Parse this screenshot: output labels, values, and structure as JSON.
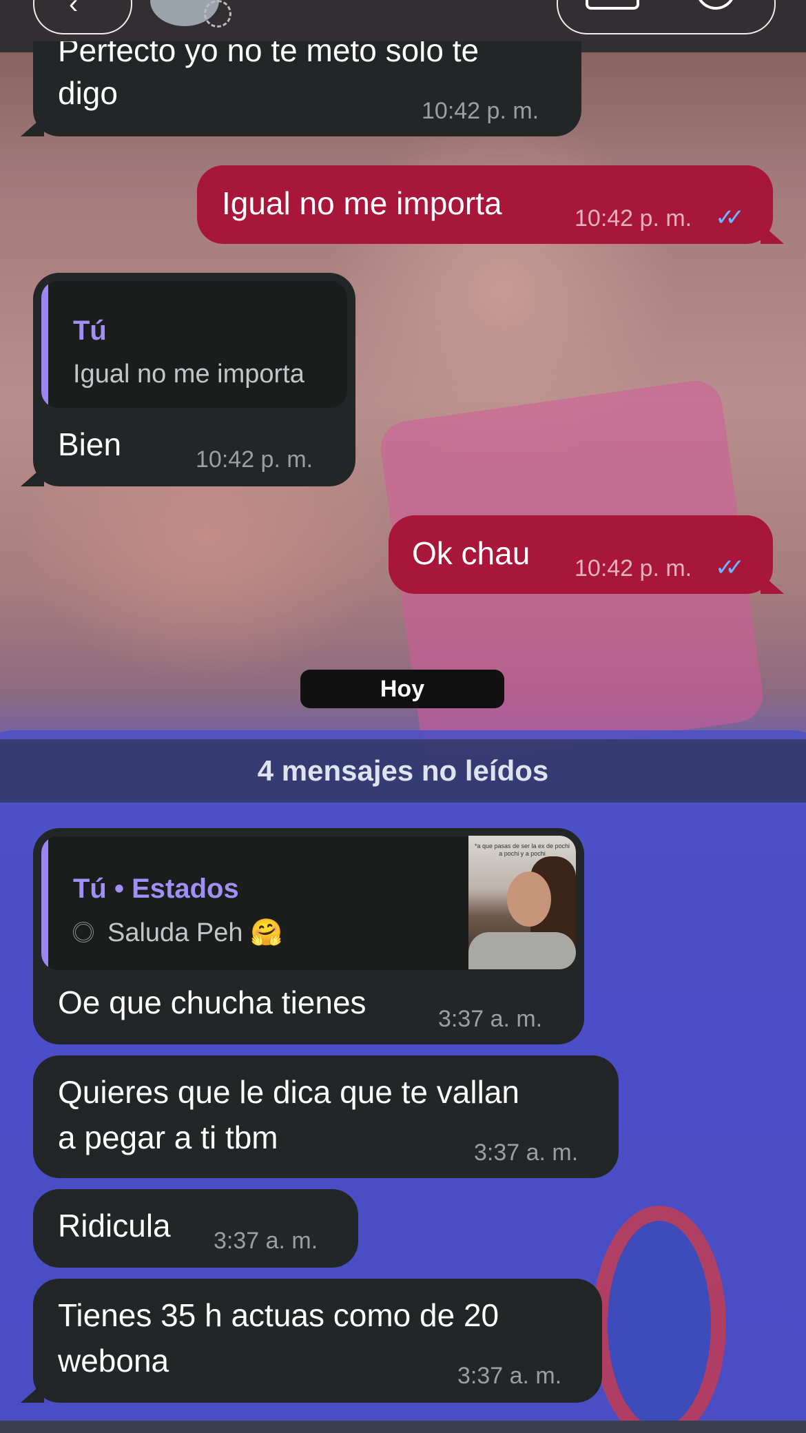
{
  "top": {
    "partial_message_top": "Perfecto yo no te meto solo te",
    "partial_message_bottom": "digo",
    "partial_time": "10:42 p. m."
  },
  "messages": [
    {
      "text": "Igual no me importa",
      "time": "10:42 p. m.",
      "ticks": "✓✓"
    },
    {
      "quote_name": "Tú",
      "quote_text": "Igual no me importa",
      "text": "Bien",
      "time": "10:42 p. m."
    },
    {
      "text": "Ok chau",
      "time": "10:42 p. m.",
      "ticks": "✓✓"
    }
  ],
  "day_label": "Hoy",
  "unread_label": "4 mensajes no leídos",
  "status_reply": {
    "quote_name": "Tú • Estados",
    "quote_text": "Saluda Peh 🤗",
    "thumb_caption": "*a que pasas de ser la ex de pochi a pochi y a pochi",
    "text": "Oe que chucha tienes",
    "time": "3:37 a. m."
  },
  "incoming": [
    {
      "line1": "Quieres que le dica que te vallan",
      "line2": "a pegar a ti tbm",
      "time": "3:37 a. m."
    },
    {
      "line1": "Ridicula",
      "time": "3:37 a. m."
    },
    {
      "line1": "Tienes 35 h actuas como de 20",
      "line2": "webona",
      "time": "3:37 a. m."
    }
  ],
  "colors": {
    "incoming_bubble": "#232626",
    "outgoing_bubble": "#a8173a",
    "quote_accent": "#9b86f4",
    "read_ticks": "#6ab7ff"
  },
  "icons": {
    "back": "chevron-left-icon",
    "video": "video-camera-icon",
    "call": "phone-icon",
    "status": "status-ring-icon"
  }
}
